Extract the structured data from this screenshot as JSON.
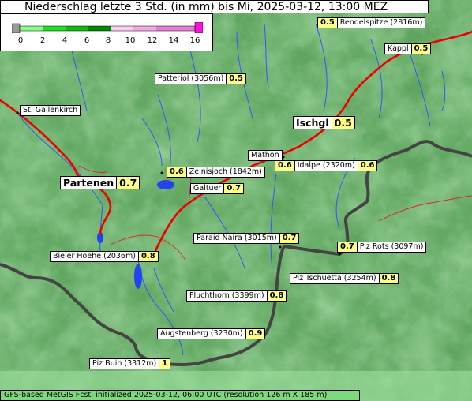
{
  "title": "Niederschlag letzte 3 Std. (in mm) bis Mi, 2025-03-12, 13:00 MEZ",
  "legend": {
    "colors": [
      "#999999",
      "#00ff00",
      "#00dd00",
      "#00bb00",
      "#009900",
      "#ffbbee",
      "#ee88dd",
      "#dd66cc",
      "#ff00ff"
    ],
    "ticks": [
      "0",
      "2",
      "4",
      "6",
      "8",
      "10",
      "12",
      "14",
      "16"
    ]
  },
  "places": [
    {
      "name": "Rendelspitze (2816m)",
      "value": "0.5"
    },
    {
      "name": "Kappl",
      "value": "0.5"
    },
    {
      "name": "Patteriol (3056m)",
      "value": "0.5"
    },
    {
      "name": "Ischgl",
      "value": "0.5"
    },
    {
      "name": "Mathon",
      "value": "0.6"
    },
    {
      "name": "Idalpe (2320m)",
      "value": "0.6"
    },
    {
      "name": "Zeinisjoch (1842m)",
      "value": "0.6"
    },
    {
      "name": "Partenen",
      "value": "0.7"
    },
    {
      "name": "Galtuer",
      "value": "0.7"
    },
    {
      "name": "Paraid Naira (3015m)",
      "value": "0.7"
    },
    {
      "name": "Piz Rots (3097m)",
      "value": "0.7"
    },
    {
      "name": "Bieler Hoehe (2036m)",
      "value": "0.8"
    },
    {
      "name": "Piz Tschuetta (3254m)",
      "value": "0.8"
    },
    {
      "name": "Fluchthorn (3399m)",
      "value": "0.8"
    },
    {
      "name": "Augstenberg (3230m)",
      "value": "0.9"
    },
    {
      "name": "Piz Buin (3312m)",
      "value": "1"
    }
  ],
  "towns": {
    "st_gallenkirch": "St. Gallenkirch"
  },
  "footer": "GFS-based MetGIS Fcst, initialized 2025-03-12, 06:00 UTC  (resolution 126 m X 185 m)"
}
